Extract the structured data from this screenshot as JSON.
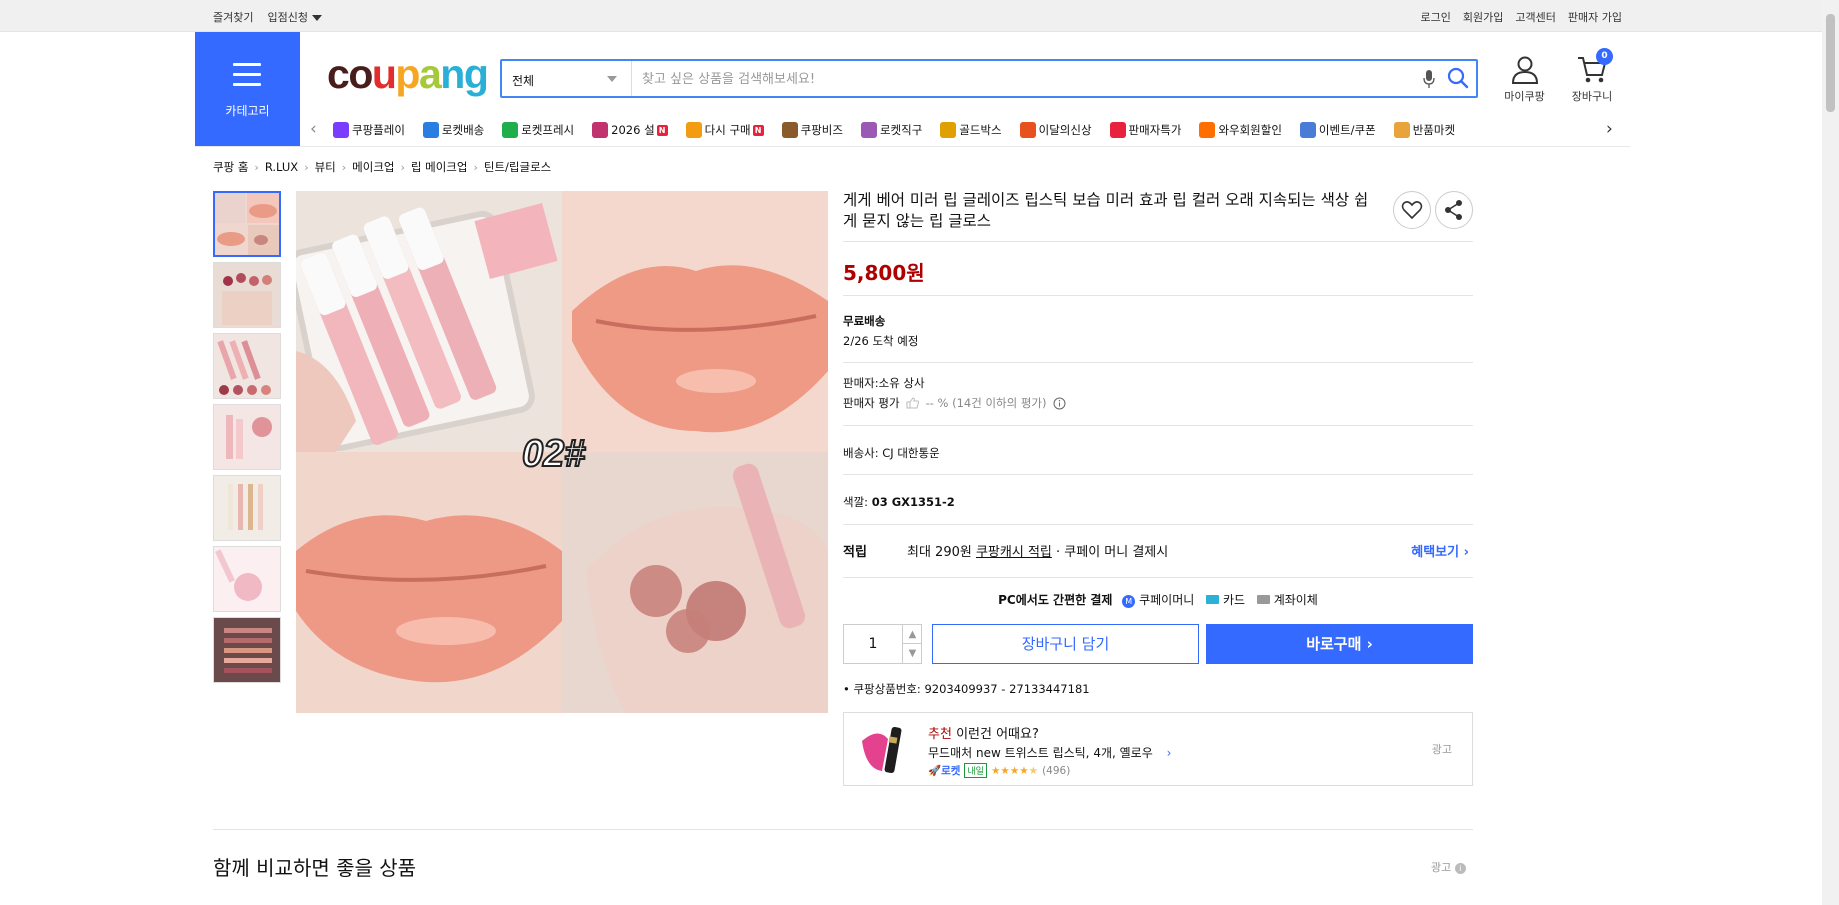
{
  "topbar": {
    "left": [
      "즐겨찾기",
      "입점신청"
    ],
    "right": [
      "로그인",
      "회원가입",
      "고객센터",
      "판매자 가입"
    ]
  },
  "header": {
    "category_label": "카테고리",
    "logo": [
      "c",
      "o",
      "u",
      "p",
      "a",
      "n",
      "g"
    ],
    "logo_colors": [
      "#4a1d1d",
      "#4a1d1d",
      "#e12d2d",
      "#f5a623",
      "#a5c93a",
      "#2ab0d6",
      "#2ab0d6"
    ],
    "search": {
      "select": "전체",
      "placeholder": "찾고 싶은 상품을 검색해보세요!"
    },
    "mycoupang": "마이쿠팡",
    "cart": "장바구니",
    "cart_count": "0"
  },
  "nav": [
    {
      "label": "쿠팡플레이",
      "icon": "play-icon",
      "color": "#7a3cff",
      "n": false
    },
    {
      "label": "로켓배송",
      "icon": "rocket-icon",
      "color": "#2a7de1",
      "n": false
    },
    {
      "label": "로켓프레시",
      "icon": "rocket-fresh-icon",
      "color": "#1fae4b",
      "n": false
    },
    {
      "label": "2026 설",
      "icon": "gift-icon",
      "color": "#c0336f",
      "n": true
    },
    {
      "label": "다시 구매",
      "icon": "rebuy-icon",
      "color": "#f39c12",
      "n": true
    },
    {
      "label": "쿠팡비즈",
      "icon": "biz-icon",
      "color": "#8b5a2b",
      "n": false
    },
    {
      "label": "로켓직구",
      "icon": "global-icon",
      "color": "#9b59b6",
      "n": false
    },
    {
      "label": "골드박스",
      "icon": "goldbox-icon",
      "color": "#e0a100",
      "n": false
    },
    {
      "label": "이달의신상",
      "icon": "new-icon",
      "color": "#e8501e",
      "n": false
    },
    {
      "label": "판매자특가",
      "icon": "sale-icon",
      "color": "#e8223c",
      "n": false
    },
    {
      "label": "와우회원할인",
      "icon": "wow-icon",
      "color": "#ff6f00",
      "n": false
    },
    {
      "label": "이벤트/쿠폰",
      "icon": "coupon-icon",
      "color": "#4a7bd6",
      "n": false
    },
    {
      "label": "반품마켓",
      "icon": "market-icon",
      "color": "#e8a33a",
      "n": false
    }
  ],
  "breadcrumb": [
    "쿠팡 홈",
    "R.LUX",
    "뷰티",
    "메이크업",
    "립 메이크업",
    "틴트/립글로스"
  ],
  "product": {
    "title": "게게 베어 미러 립 글레이즈 립스틱 보습 미러 효과 립 컬러 오래 지속되는 색상 쉽게 묻지 않는 립 글로스",
    "image_text": "02#",
    "price": "5,800원",
    "shipping": {
      "label": "무료배송",
      "eta": "2/26 도착 예정"
    },
    "seller": "판매자:소유 상사",
    "seller_rating_label": "판매자 평가",
    "seller_rating_value": "-- % (14건 이하의 평가)",
    "carrier": "배송사:  CJ 대한통운",
    "color_label": "색깔:",
    "color_value": "03 GX1351-2",
    "reward": {
      "label": "적립",
      "text1": "최대 290원",
      "link": "쿠팡캐시 적립",
      "text2": "· 쿠페이 머니 결제시",
      "more": "혜택보기"
    },
    "pay": {
      "label": "PC에서도 간편한 결제",
      "opt1": "쿠페이머니",
      "opt2": "카드",
      "opt3": "계좌이체"
    },
    "qty": "1",
    "cart_btn": "장바구니 담기",
    "buy_btn": "바로구매",
    "product_no": "쿠팡상품번호: 9203409937 - 27133447181"
  },
  "reco": {
    "prefix": "추천",
    "title": "이런건 어때요?",
    "name": "무드매처 new 트위스트 립스틱, 4개, 옐로우",
    "rocket": "로켓",
    "tomorrow": "내일",
    "stars": 4.5,
    "reviews": "(496)",
    "ad": "광고"
  },
  "section": {
    "title": "함께 비교하면 좋을 상품",
    "ad": "광고"
  }
}
